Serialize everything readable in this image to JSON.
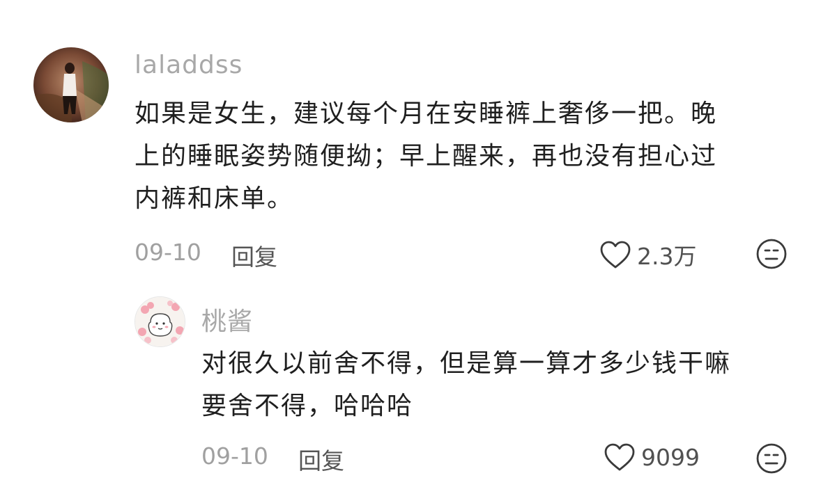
{
  "comments": [
    {
      "username": "laladdss",
      "text_lines": [
        "如果是女生，建议每个月在安睡裤上奢侈一把。晚",
        "上的睡眠姿势随便拗；早上醒来，再也没有担心过",
        "内裤和床单。"
      ],
      "date": "09-10",
      "reply_label": "回复",
      "likes": "2.3万",
      "avatar_icon": "user-photo-avatar",
      "like_icon": "heart-icon",
      "dislike_icon": "unhappy-face-icon"
    },
    {
      "username": "桃酱",
      "text_lines": [
        "对很久以前舍不得，但是算一算才多少钱干嘛",
        "要舍不得，哈哈哈"
      ],
      "date": "09-10",
      "reply_label": "回复",
      "likes": "9099",
      "avatar_icon": "cartoon-sheep-avatar",
      "like_icon": "heart-icon",
      "dislike_icon": "unhappy-face-icon"
    }
  ],
  "colors": {
    "username": "#a8a8a8",
    "body_text": "#1f1f1f",
    "meta": "#a0a0a0",
    "icon": "#3a3a3a"
  }
}
